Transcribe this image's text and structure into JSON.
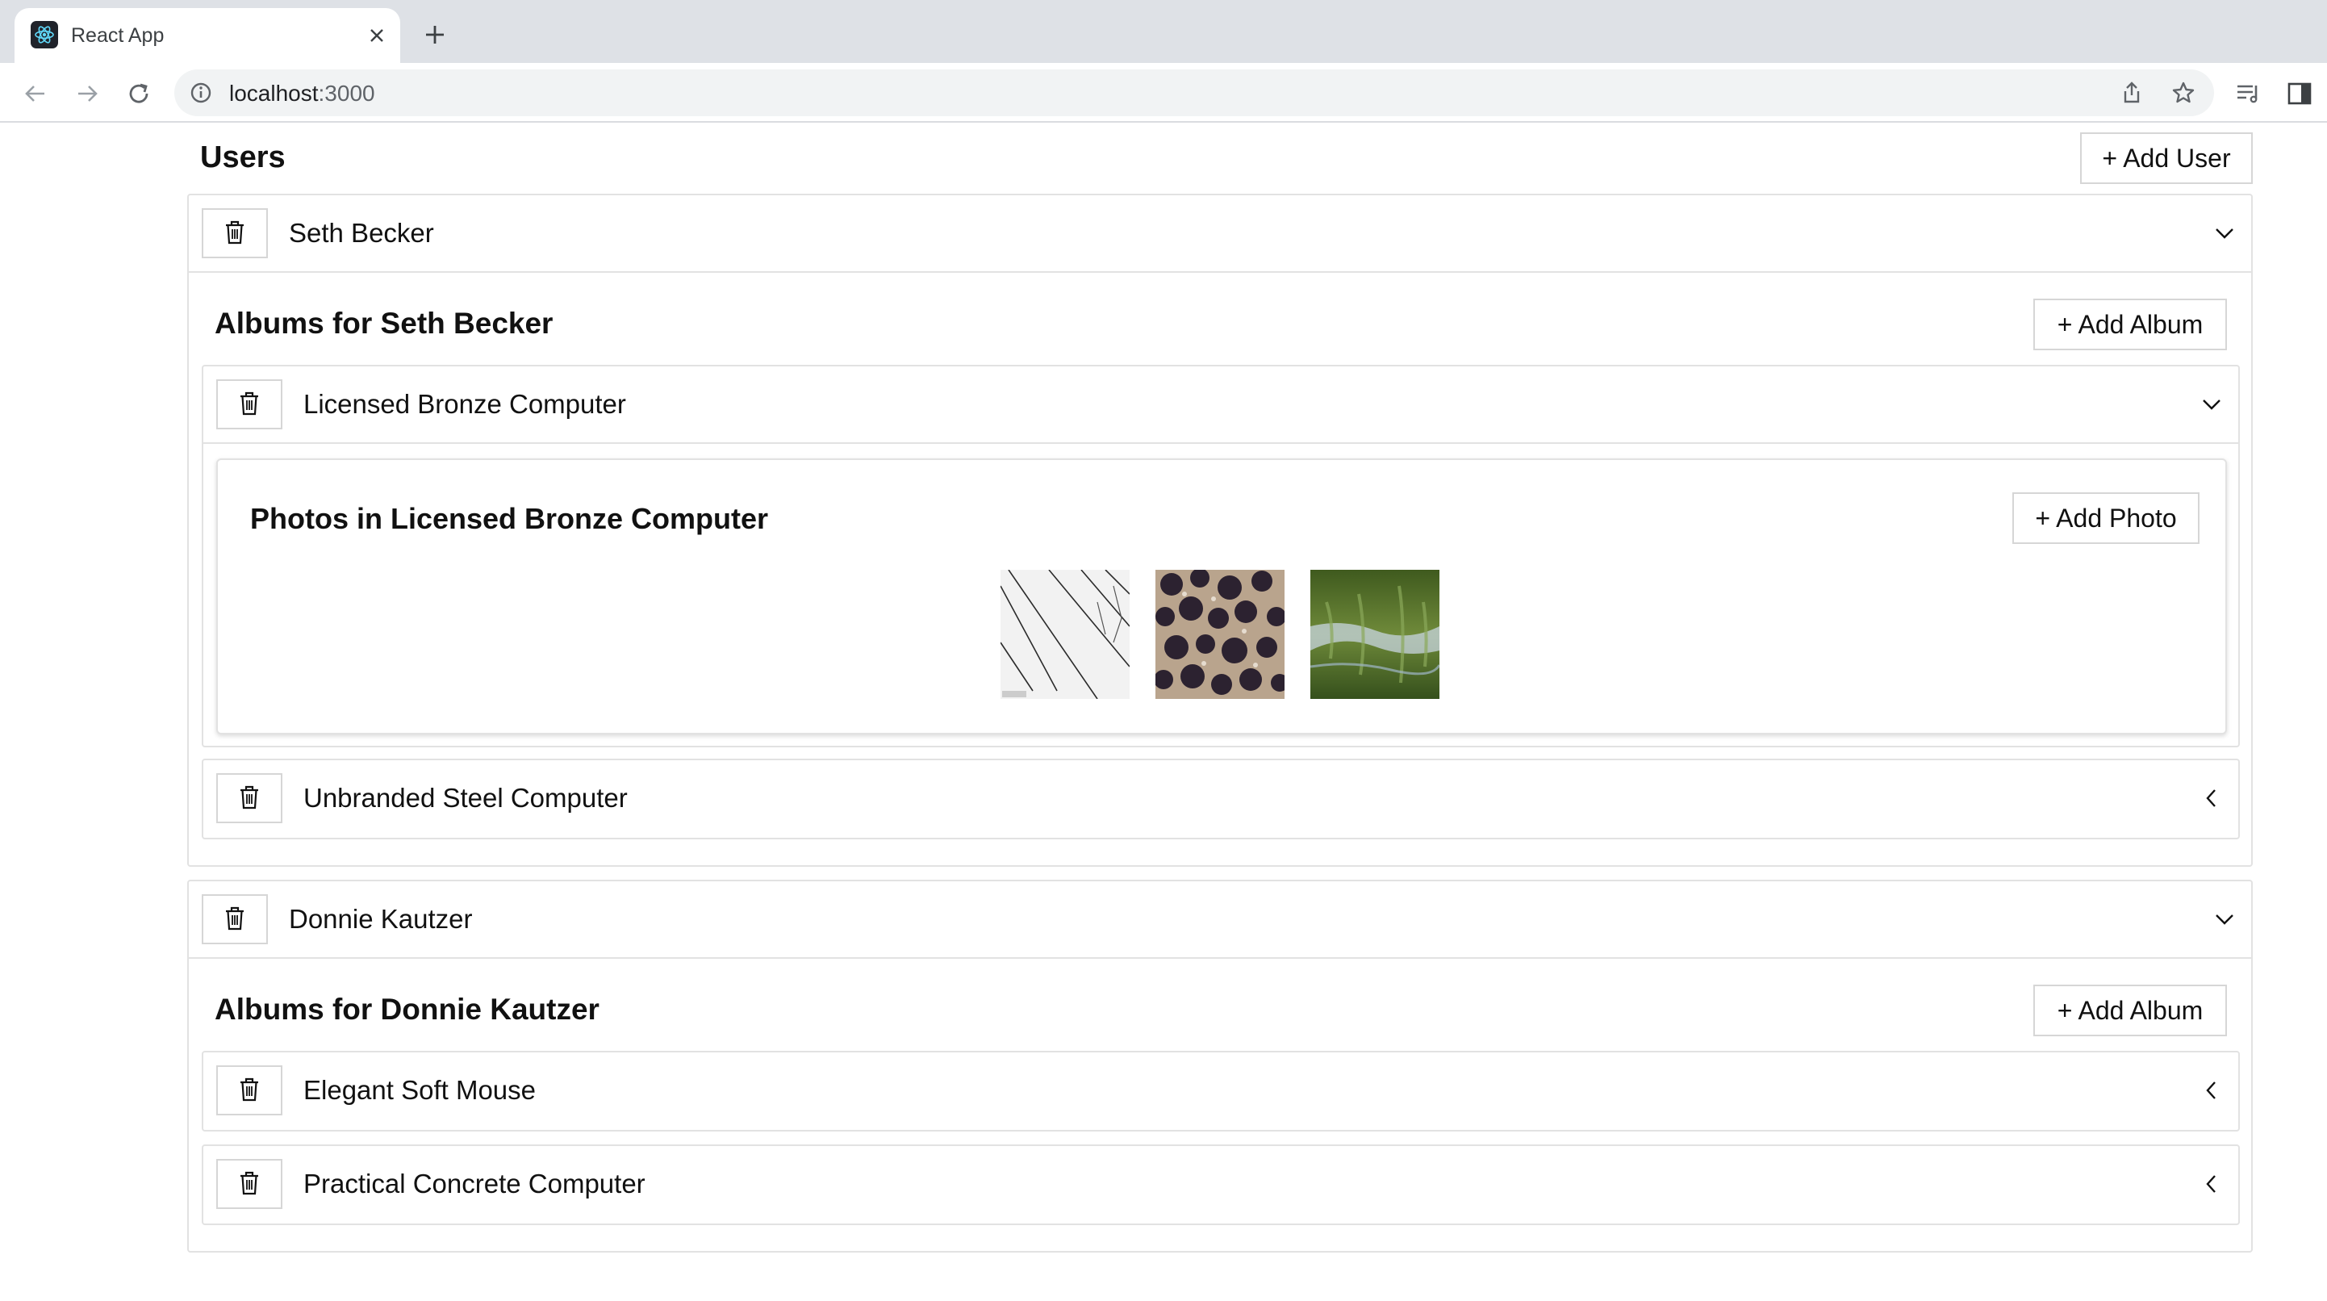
{
  "browser": {
    "tab_title": "React App",
    "url_host": "localhost",
    "url_port": ":3000"
  },
  "app": {
    "title": "Users",
    "add_user_label": "+ Add User",
    "users": [
      {
        "name": "Seth Becker",
        "albums_heading": "Albums for Seth Becker",
        "add_album_label": "+ Add Album",
        "albums": [
          {
            "title": "Licensed Bronze Computer",
            "expanded": true,
            "photos_heading": "Photos in Licensed Bronze Computer",
            "add_photo_label": "+ Add Photo",
            "photos": [
              "abstract-lines",
              "dark-spots-pattern",
              "green-water-reflection"
            ]
          },
          {
            "title": "Unbranded Steel Computer",
            "expanded": false
          }
        ]
      },
      {
        "name": "Donnie Kautzer",
        "albums_heading": "Albums for Donnie Kautzer",
        "add_album_label": "+ Add Album",
        "albums": [
          {
            "title": "Elegant Soft Mouse",
            "expanded": false
          },
          {
            "title": "Practical Concrete Computer",
            "expanded": false
          }
        ]
      }
    ]
  },
  "colors": {
    "border": "#e2e2e2",
    "button_border": "#d6d6d6",
    "chrome_tabbar": "#dee1e6",
    "omnibox": "#f1f3f4"
  }
}
